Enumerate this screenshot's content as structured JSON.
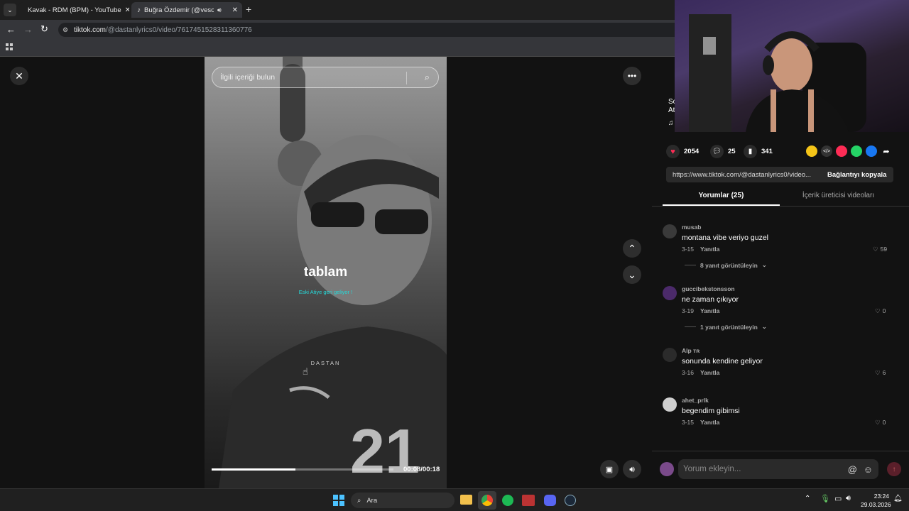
{
  "browser": {
    "tabs": [
      {
        "title": "Kavak - RDM (BPM) - YouTube"
      },
      {
        "title": "Buğra Özdemir (@vesofps)"
      }
    ],
    "url_domain": "tiktok.com",
    "url_path": "/@dastanlyrics0/video/7617451528311360776"
  },
  "video": {
    "search_placeholder": "İlgili içeriği bulun",
    "caption_main": "tablam",
    "caption_sub": "Eski Atiye geri geliyor !",
    "watermark": "DASTAN",
    "jersey_number": "21",
    "time": "00:08/00:18",
    "progress": 0.46
  },
  "panel": {
    "likes": "2054",
    "comments": "25",
    "saves": "341",
    "link": "https://www.tiktok.com/@dastanlyrics0/video...",
    "copy_label": "Bağlantıyı kopyala",
    "tab_comments": "Yorumlar (25)",
    "tab_creator": "İçerik üreticisi videoları",
    "partial_title_1": "So",
    "partial_title_2": "At",
    "comment_input_placeholder": "Yorum ekleyin...",
    "comments_list": [
      {
        "user": "musab",
        "text": "montana vibe veriyo guzel",
        "date": "3-15",
        "reply": "Yanıtla",
        "likes": "59",
        "replies": "8 yanıt görüntüleyin"
      },
      {
        "user": "guccibekstonsson",
        "text": "ne zaman çıkıyor",
        "date": "3-19",
        "reply": "Yanıtla",
        "likes": "0",
        "replies": "1 yanıt görüntüleyin"
      },
      {
        "user": "Alp ᴛʀ",
        "text": "sonunda kendine geliyor",
        "date": "3-16",
        "reply": "Yanıtla",
        "likes": "6"
      },
      {
        "user": "ahet_prlk",
        "text": "begendim gibimsi",
        "date": "3-15",
        "reply": "Yanıtla",
        "likes": "0"
      }
    ]
  },
  "taskbar": {
    "search_label": "Ara",
    "time": "23:24",
    "date": "29.03.2026"
  },
  "colors": {
    "accent": "#fe2c55",
    "teal": "#25d9d9"
  }
}
